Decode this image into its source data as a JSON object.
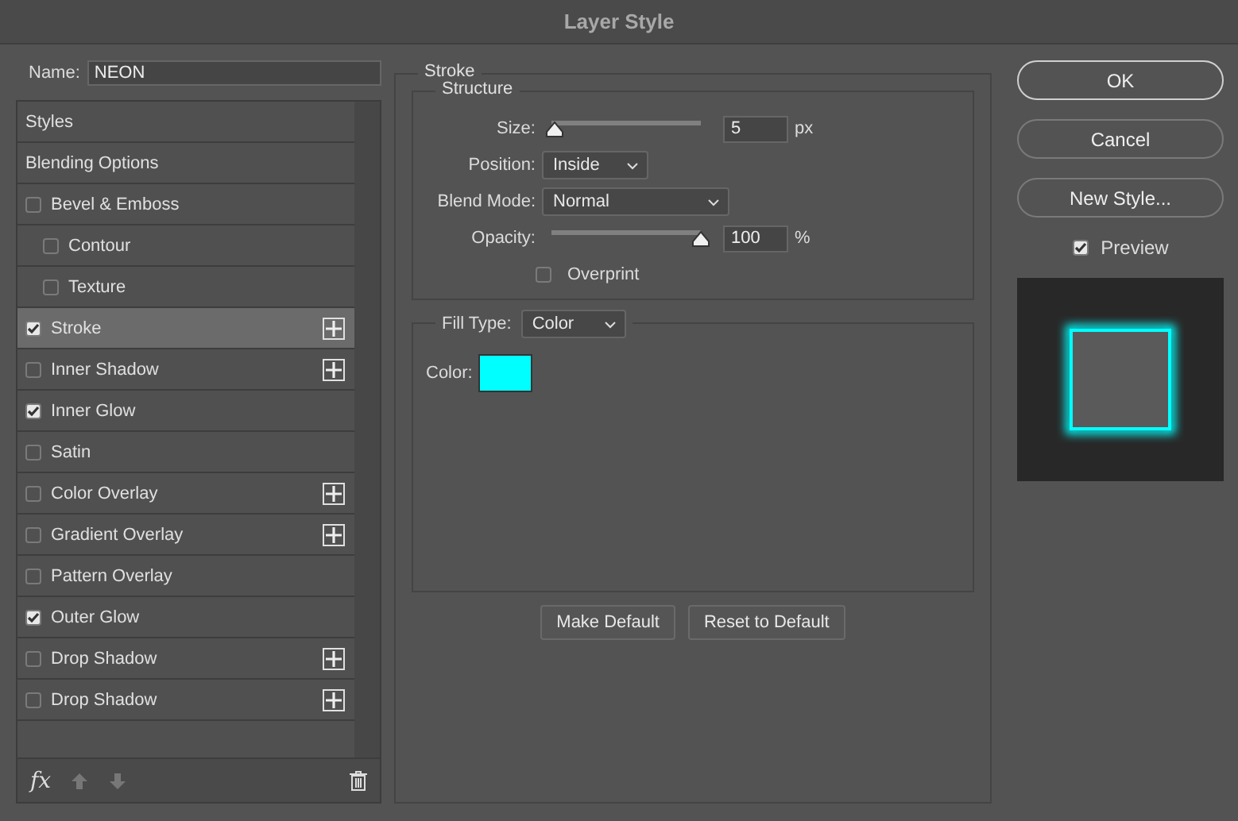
{
  "window": {
    "title": "Layer Style"
  },
  "name_field": {
    "label": "Name:",
    "value": "NEON"
  },
  "styles_list": [
    {
      "kind": "header",
      "label": "Styles",
      "selected": false
    },
    {
      "kind": "header",
      "label": "Blending Options",
      "selected": false
    },
    {
      "kind": "effect",
      "label": "Bevel & Emboss",
      "checked": false,
      "selected": false,
      "addable": false,
      "children": [
        {
          "kind": "effect",
          "label": "Contour",
          "checked": false,
          "selected": false,
          "addable": false
        },
        {
          "kind": "effect",
          "label": "Texture",
          "checked": false,
          "selected": false,
          "addable": false
        }
      ]
    },
    {
      "kind": "effect",
      "label": "Stroke",
      "checked": true,
      "selected": true,
      "addable": true
    },
    {
      "kind": "effect",
      "label": "Inner Shadow",
      "checked": false,
      "selected": false,
      "addable": true
    },
    {
      "kind": "effect",
      "label": "Inner Glow",
      "checked": true,
      "selected": false,
      "addable": false
    },
    {
      "kind": "effect",
      "label": "Satin",
      "checked": false,
      "selected": false,
      "addable": false
    },
    {
      "kind": "effect",
      "label": "Color Overlay",
      "checked": false,
      "selected": false,
      "addable": true
    },
    {
      "kind": "effect",
      "label": "Gradient Overlay",
      "checked": false,
      "selected": false,
      "addable": true
    },
    {
      "kind": "effect",
      "label": "Pattern Overlay",
      "checked": false,
      "selected": false,
      "addable": false
    },
    {
      "kind": "effect",
      "label": "Outer Glow",
      "checked": true,
      "selected": false,
      "addable": false
    },
    {
      "kind": "effect",
      "label": "Drop Shadow",
      "checked": false,
      "selected": false,
      "addable": true
    },
    {
      "kind": "effect",
      "label": "Drop Shadow",
      "checked": false,
      "selected": false,
      "addable": true
    }
  ],
  "list_footer": {
    "fx": "fx"
  },
  "stroke": {
    "title": "Stroke",
    "structure": {
      "title": "Structure",
      "size": {
        "label": "Size:",
        "level": 0.02,
        "value": "5",
        "unit": "px"
      },
      "position": {
        "label": "Position:",
        "value": "Inside"
      },
      "blend_mode": {
        "label": "Blend Mode:",
        "value": "Normal"
      },
      "opacity": {
        "label": "Opacity:",
        "level": 1.0,
        "value": "100",
        "unit": "%"
      },
      "overprint": {
        "label": "Overprint",
        "checked": false
      }
    },
    "fill": {
      "label": "Fill Type:",
      "value": "Color",
      "color_label": "Color:",
      "color": "#00ffff"
    },
    "buttons": [
      "Make Default",
      "Reset to Default"
    ]
  },
  "buttons": [
    {
      "label": "OK",
      "default": true
    },
    {
      "label": "Cancel",
      "default": false
    },
    {
      "label": "New Style...",
      "default": false
    }
  ],
  "preview": {
    "label": "Preview",
    "checked": true
  }
}
